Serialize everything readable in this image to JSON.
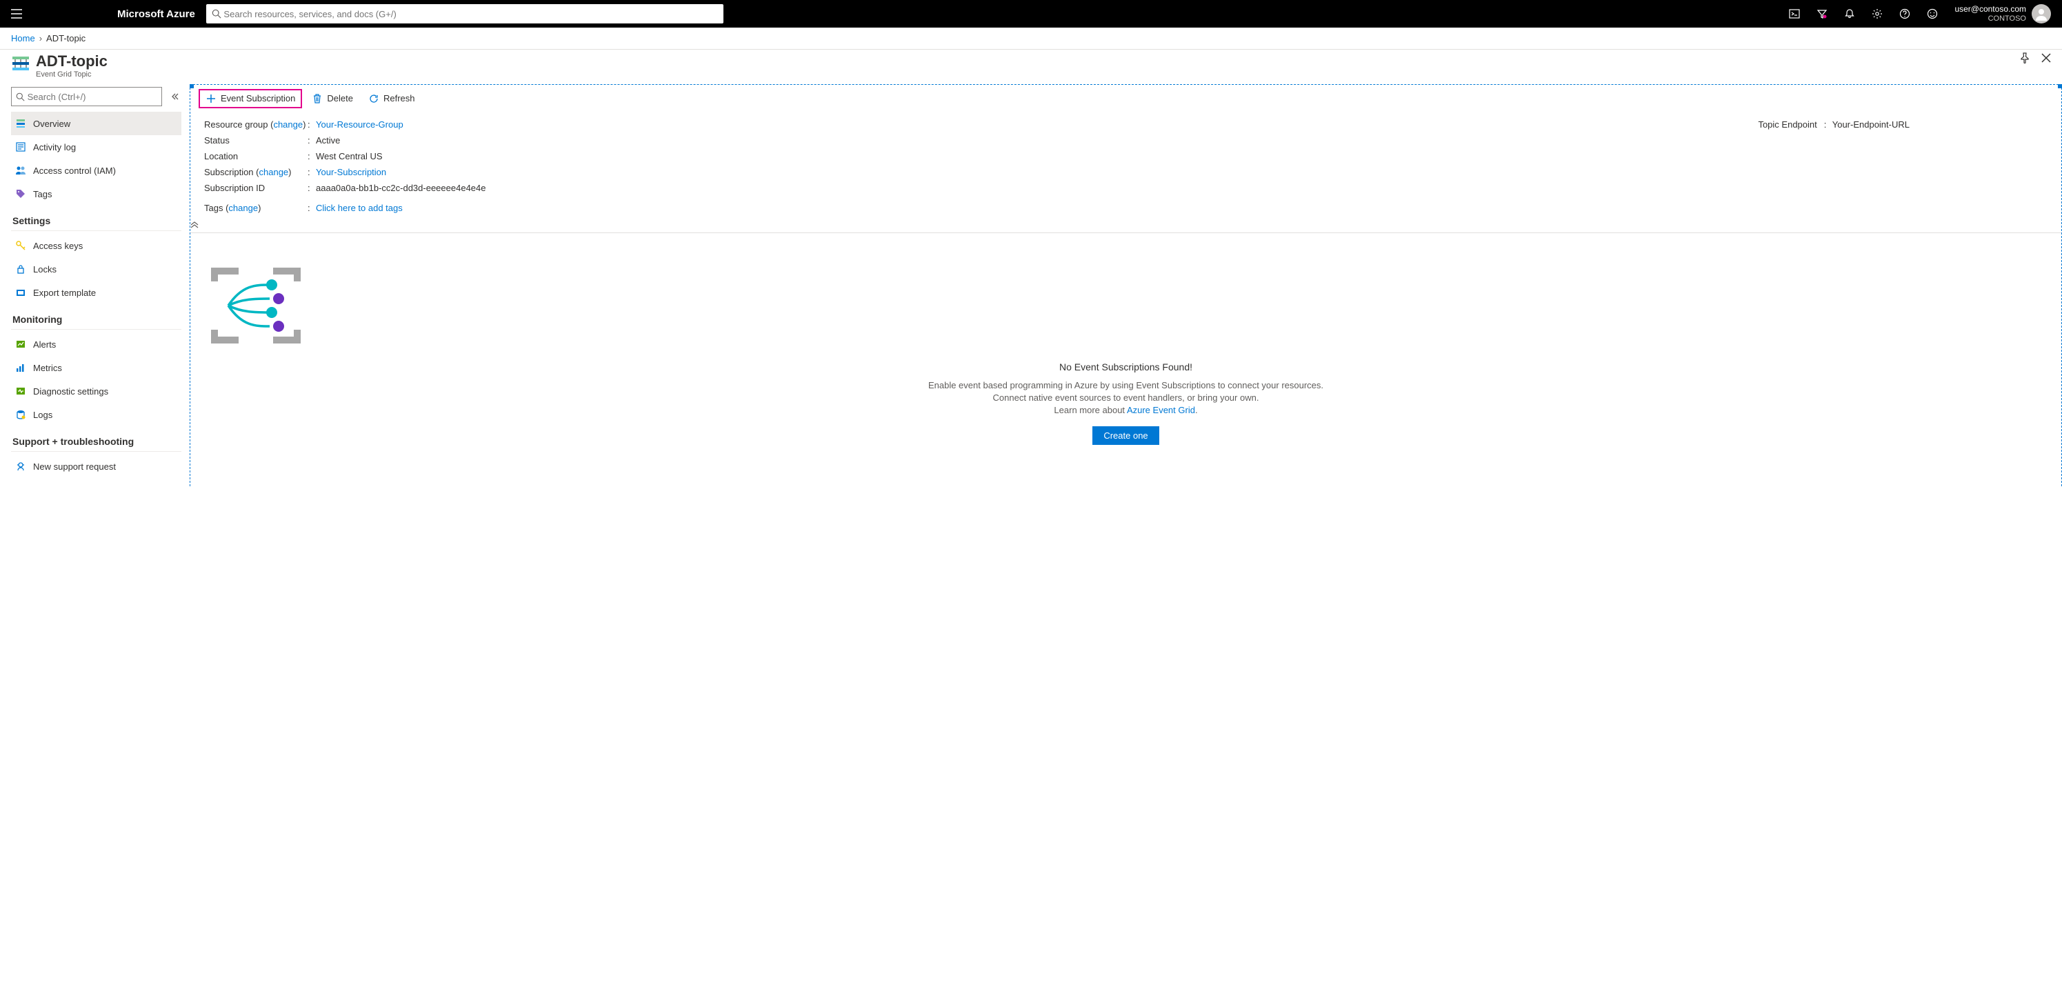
{
  "header": {
    "brand": "Microsoft Azure",
    "search_placeholder": "Search resources, services, and docs (G+/)",
    "account": {
      "email": "user@contoso.com",
      "tenant": "CONTOSO"
    }
  },
  "breadcrumb": {
    "home": "Home",
    "current": "ADT-topic"
  },
  "page": {
    "title": "ADT-topic",
    "subtitle": "Event Grid Topic"
  },
  "sidebar": {
    "search_placeholder": "Search (Ctrl+/)",
    "items": {
      "overview": "Overview",
      "activity_log": "Activity log",
      "iam": "Access control (IAM)",
      "tags": "Tags"
    },
    "settings_label": "Settings",
    "settings": {
      "access_keys": "Access keys",
      "locks": "Locks",
      "export": "Export template"
    },
    "monitoring_label": "Monitoring",
    "monitoring": {
      "alerts": "Alerts",
      "metrics": "Metrics",
      "diag": "Diagnostic settings",
      "logs": "Logs"
    },
    "support_label": "Support + troubleshooting",
    "support": {
      "new_request": "New support request"
    }
  },
  "toolbar": {
    "event_sub": "Event Subscription",
    "delete": "Delete",
    "refresh": "Refresh"
  },
  "props": {
    "rg_label": "Resource group",
    "rg_change": "change",
    "rg_value": "Your-Resource-Group",
    "status_label": "Status",
    "status_value": "Active",
    "location_label": "Location",
    "location_value": "West Central US",
    "sub_label": "Subscription",
    "sub_change": "change",
    "sub_value": "Your-Subscription",
    "subid_label": "Subscription ID",
    "subid_value": "aaaa0a0a-bb1b-cc2c-dd3d-eeeeee4e4e4e",
    "tags_label": "Tags",
    "tags_change": "change",
    "tags_value": "Click here to add tags",
    "endpoint_label": "Topic Endpoint",
    "endpoint_value": "Your-Endpoint-URL"
  },
  "empty": {
    "title": "No Event Subscriptions Found!",
    "line1": "Enable event based programming in Azure by using Event Subscriptions to connect your resources.",
    "line2": "Connect native event sources to event handlers, or bring your own.",
    "learn_prefix": "Learn more about ",
    "learn_link": "Azure Event Grid",
    "button": "Create one"
  }
}
